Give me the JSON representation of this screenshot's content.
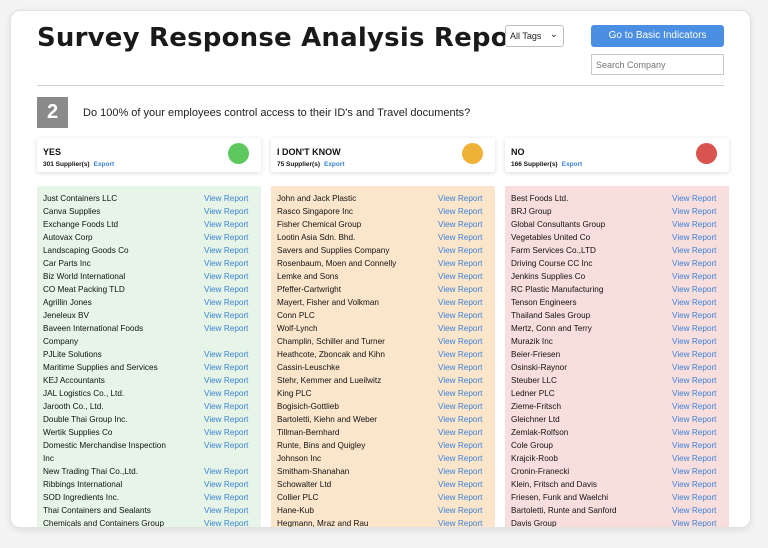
{
  "header": {
    "title": "Survey Response Analysis Report",
    "tag_select": "All Tags",
    "basic_button": "Go to Basic Indicators",
    "search_placeholder": "Search Company"
  },
  "question": {
    "number": "2",
    "text": "Do 100% of your employees control access to their ID's and Travel documents?"
  },
  "view_label": "View Report",
  "columns": [
    {
      "label": "YES",
      "count": "301 Supplier(s)",
      "export": "Export",
      "dot_color": "#5ec85e",
      "bg": "#e6f5e7",
      "rows": [
        {
          "name": "Just Containers LLC",
          "link": true
        },
        {
          "name": "Canva Supplies",
          "link": true
        },
        {
          "name": "Exchange Foods Ltd",
          "link": true
        },
        {
          "name": "Autovax Corp",
          "link": true
        },
        {
          "name": "Landscaping Goods Co",
          "link": true
        },
        {
          "name": "Car Parts Inc",
          "link": true
        },
        {
          "name": "Biz World International",
          "link": true
        },
        {
          "name": "CO Meat Packing TLD",
          "link": true
        },
        {
          "name": "Agrillin Jones",
          "link": true
        },
        {
          "name": "Jeneleux BV",
          "link": true
        },
        {
          "name": "Baveen International Foods",
          "link": true
        },
        {
          "name": "Company",
          "link": false
        },
        {
          "name": "PJLite Solutions",
          "link": true
        },
        {
          "name": "Maritime Supplies and Services",
          "link": true
        },
        {
          "name": "KEJ Accountants",
          "link": true
        },
        {
          "name": "JAL Logistics Co., Ltd.",
          "link": true
        },
        {
          "name": "Jarooth Co., Ltd.",
          "link": true
        },
        {
          "name": "Double Thai Group Inc.",
          "link": true
        },
        {
          "name": "Wertik Supplies Co",
          "link": true
        },
        {
          "name": "Domestic Merchandise Inspection",
          "link": true
        },
        {
          "name": "Inc",
          "link": false
        },
        {
          "name": "New Trading Thai Co.,Ltd.",
          "link": true
        },
        {
          "name": "Ribbings International",
          "link": true
        },
        {
          "name": "SOD Ingredients Inc.",
          "link": true
        },
        {
          "name": "Thai Containers and Sealants",
          "link": true
        },
        {
          "name": "Chemicals and Containers Group",
          "link": true
        }
      ]
    },
    {
      "label": "I DON'T KNOW",
      "count": "75 Supplier(s)",
      "export": "Export",
      "dot_color": "#f0b138",
      "bg": "#fbe6cc",
      "rows": [
        {
          "name": "John and Jack Plastic",
          "link": true
        },
        {
          "name": "Rasco Singapore Inc",
          "link": true
        },
        {
          "name": "Fisher Chemical Group",
          "link": true
        },
        {
          "name": "Lootin Asia Sdn. Bhd.",
          "link": true
        },
        {
          "name": "Savers and Supplies Company",
          "link": true
        },
        {
          "name": "Rosenbaum, Moen and Connelly",
          "link": true
        },
        {
          "name": "Lemke and Sons",
          "link": true
        },
        {
          "name": "Pfeffer-Cartwright",
          "link": true
        },
        {
          "name": "Mayert, Fisher and Volkman",
          "link": true
        },
        {
          "name": "Conn PLC",
          "link": true
        },
        {
          "name": "Wolf-Lynch",
          "link": true
        },
        {
          "name": "Champlin, Schiller and Turner",
          "link": true
        },
        {
          "name": "Heathcote, Zboncak and Kihn",
          "link": true
        },
        {
          "name": "Cassin-Leuschke",
          "link": true
        },
        {
          "name": "Stehr, Kemmer and Lueilwitz",
          "link": true
        },
        {
          "name": "King PLC",
          "link": true
        },
        {
          "name": "Bogisich-Gottlieb",
          "link": true
        },
        {
          "name": "Bartoletti, Kiehn and Weber",
          "link": true
        },
        {
          "name": "Tillman-Bernhard",
          "link": true
        },
        {
          "name": "Runte, Bins and Quigley",
          "link": true
        },
        {
          "name": "Johnson Inc",
          "link": true
        },
        {
          "name": "Smitham-Shanahan",
          "link": true
        },
        {
          "name": "Schowalter Ltd",
          "link": true
        },
        {
          "name": "Collier PLC",
          "link": true
        },
        {
          "name": "Hane-Kub",
          "link": true
        },
        {
          "name": "Hegmann, Mraz and Rau",
          "link": true
        }
      ]
    },
    {
      "label": "NO",
      "count": "166 Supplier(s)",
      "export": "Export",
      "dot_color": "#d9534f",
      "bg": "#f9dede",
      "rows": [
        {
          "name": "Best Foods Ltd.",
          "link": true
        },
        {
          "name": "BRJ Group",
          "link": true
        },
        {
          "name": "Global Consultants Group",
          "link": true
        },
        {
          "name": "Vegetables United Co",
          "link": true
        },
        {
          "name": "Farm Services Co.,LTD",
          "link": true
        },
        {
          "name": "Driving Course CC Inc",
          "link": true
        },
        {
          "name": "Jenkins Supplies Co",
          "link": true
        },
        {
          "name": "RC Plastic Manufacturing",
          "link": true
        },
        {
          "name": "Tenson Engineers",
          "link": true
        },
        {
          "name": "Thailand Sales Group",
          "link": true
        },
        {
          "name": "Mertz, Conn and Terry",
          "link": true
        },
        {
          "name": "Murazik Inc",
          "link": true
        },
        {
          "name": "Beier-Friesen",
          "link": true
        },
        {
          "name": "Osinski-Raynor",
          "link": true
        },
        {
          "name": "Steuber LLC",
          "link": true
        },
        {
          "name": "Ledner PLC",
          "link": true
        },
        {
          "name": "Zieme-Fritsch",
          "link": true
        },
        {
          "name": "Gleichner Ltd",
          "link": true
        },
        {
          "name": "Zemlak-Rolfson",
          "link": true
        },
        {
          "name": "Cole Group",
          "link": true
        },
        {
          "name": "Krajcik-Roob",
          "link": true
        },
        {
          "name": "Cronin-Franecki",
          "link": true
        },
        {
          "name": "Klein, Fritsch and Davis",
          "link": true
        },
        {
          "name": "Friesen, Funk and Waelchi",
          "link": true
        },
        {
          "name": "Bartoletti, Runte and Sanford",
          "link": true
        },
        {
          "name": "Davis Group",
          "link": true
        }
      ]
    }
  ]
}
